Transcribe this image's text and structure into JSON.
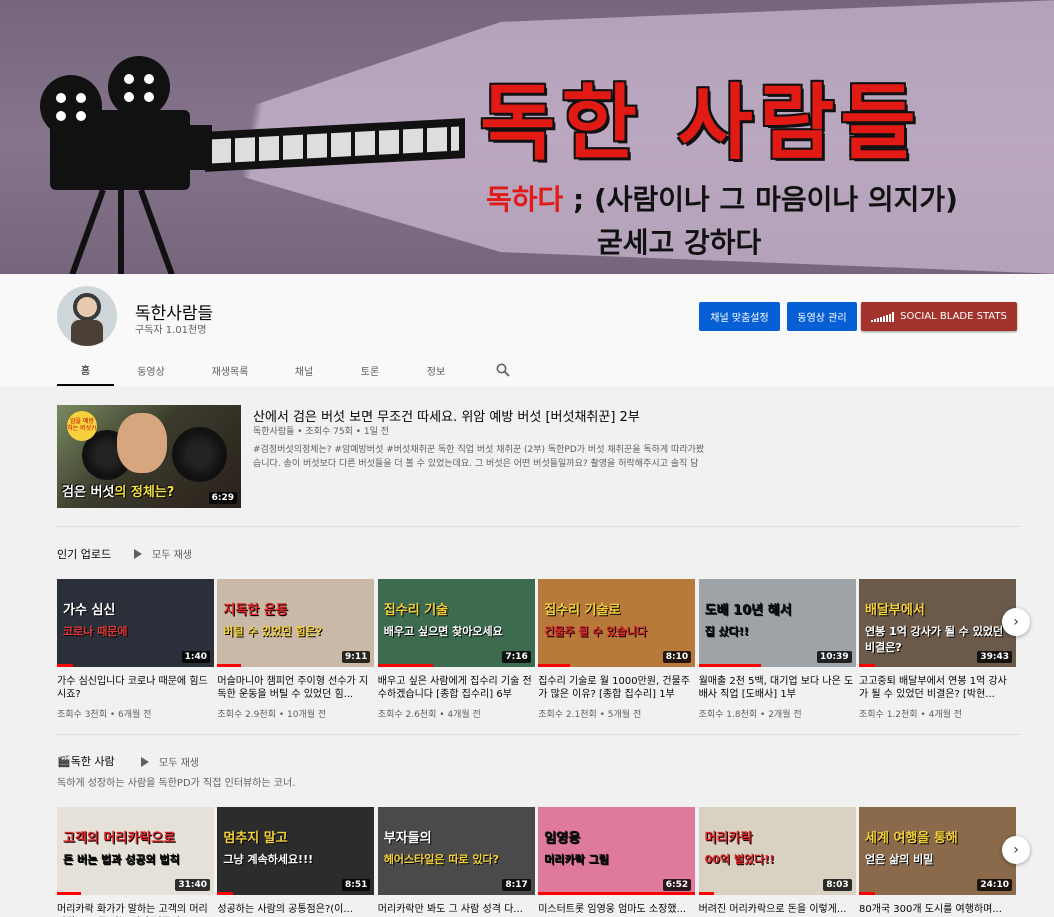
{
  "banner": {
    "title": "독한 사람들",
    "subtitle_highlight": "독하다",
    "subtitle_rest": " ; (사람이나 그 마음이나 의지가)",
    "subtitle_line2": "굳세고 강하다"
  },
  "channel": {
    "name": "독한사람들",
    "subscribers": "구독자 1.01천명"
  },
  "buttons": {
    "customize": "채널 맞춤설정",
    "manage": "동영상 관리",
    "socialblade": "SOCIAL BLADE STATS"
  },
  "tabs": [
    "홈",
    "동영상",
    "재생목록",
    "채널",
    "토론",
    "정보"
  ],
  "featured": {
    "title": "산에서 검은 버섯 보면 무조건 따세요. 위암 예방 버섯 [버섯채취꾼] 2부",
    "meta": "독한사람들 • 조회수 75회 • 1일 전",
    "description": "#검정버섯의정체는? #암예방버섯 #버섯채취꾼 독한 직업 버섯 채취꾼 (2부) 독한PD가 버섯 채취꾼을 독하게 따라가봤습니다. 송이 버섯보다 다른 버섯들을 더 볼 수 있었는데요. 그 버섯은 어떤 버섯들일까요? 촬영을 허락해주시고 솔직 담",
    "thumb_tag": "암을 예방 하는 버섯?!",
    "thumb_caption_a": "검은 버섯",
    "thumb_caption_b": "의 정체는?",
    "duration": "6:29"
  },
  "shelf1": {
    "title": "인기 업로드",
    "play_all": "모두 재생",
    "videos": [
      {
        "title": "가수 심신입니다 코로나 때문에 힘드시죠?",
        "meta": "조회수 3천회 • 6개월 전",
        "duration": "1:40",
        "t1": "가수 심신",
        "t2": "코로나 때문에",
        "bg": "#2b2f3a",
        "c1": "#ffffff",
        "c2": "#e03a3a",
        "progress": 0.1
      },
      {
        "title": "머슬마니아 챔피언 주이형 선수가 지독한 운동을 버틸 수 있었던 힘...",
        "meta": "조회수 2.9천회 • 10개월 전",
        "duration": "9:11",
        "t1": "지독한 운동",
        "t2": "버틸 수 있었던 힘은?",
        "bg": "#c9b9a6",
        "c1": "#e02a2a",
        "c2": "#f4d13d",
        "progress": 0.15
      },
      {
        "title": "배우고 싶은 사람에게 집수리 기술 전수하겠습니다 [종합 집수리] 6부",
        "meta": "조회수 2.6천회 • 4개월 전",
        "duration": "7:16",
        "t1": "집수리 기술",
        "t2": "배우고 싶으면 찾아오세요",
        "bg": "#3d6b4f",
        "c1": "#f4d13d",
        "c2": "#ffffff",
        "progress": 0.35
      },
      {
        "title": "집수리 기술로 월 1000만원, 건물주가 많은 이유? [종합 집수리] 1부",
        "meta": "조회수 2.1천회 • 5개월 전",
        "duration": "8:10",
        "t1": "집수리 기술로",
        "t2": "건물주 될 수 있습니다",
        "bg": "#b87a3a",
        "c1": "#f4d13d",
        "c2": "#e02a2a",
        "progress": 0.2
      },
      {
        "title": "월매출 2천 5백, 대기업 보다 나은 도배사 직업 [도배사] 1부",
        "meta": "조회수 1.8천회 • 2개월 전",
        "duration": "10:39",
        "t1": "도배 10년 해서",
        "t2": "집 샀다!!",
        "bg": "#9ea3a8",
        "c1": "#111111",
        "c2": "#111111",
        "progress": 0.4
      },
      {
        "title": "고고중퇴 배달부에서 연봉 1억 강사가 될 수 있었던 비결은? [박현...",
        "meta": "조회수 1.2천회 • 4개월 전",
        "duration": "39:43",
        "t1": "배달부에서",
        "t2": "연봉 1억 강사가 될 수 있었던 비결은?",
        "bg": "#6b5a4a",
        "c1": "#f4d13d",
        "c2": "#ffffff",
        "progress": 0.1
      }
    ]
  },
  "shelf2": {
    "title": "🎬독한 사람",
    "play_all": "모두 재생",
    "description": "독하게 성장하는 사람을 독한PD가 직접 인터뷰하는 코너.",
    "videos": [
      {
        "title": "머리카락 화가가 말하는 고객의 머리카락으로 돈 버는 법과 성공의...",
        "duration": "31:40",
        "t1": "고객의 머리카락으로",
        "t2": "돈 버는 법과 성공의 법칙",
        "bg": "#e6e1d8",
        "c1": "#e02a2a",
        "c2": "#111111",
        "progress": 0.15
      },
      {
        "title": "성공하는 사람의 공통점은?(이...",
        "duration": "8:51",
        "t1": "멈추지 말고",
        "t2": "그냥 계속하세요!!!",
        "bg": "#2c2c2c",
        "c1": "#f4d13d",
        "c2": "#ffffff",
        "progress": 0.1
      },
      {
        "title": "머리카락만 봐도 그 사람 성격 다...",
        "duration": "8:17",
        "t1": "부자들의",
        "t2": "헤어스타일은 따로 있다?",
        "bg": "#4a4a4a",
        "c1": "#ffffff",
        "c2": "#f4d13d",
        "progress": 0.0
      },
      {
        "title": "미스터트롯 임영웅 엄마도 소장했...",
        "duration": "6:52",
        "t1": "임영웅",
        "t2": "머리카락 그림",
        "bg": "#e07a9a",
        "c1": "#111111",
        "c2": "#111111",
        "progress": 1.0
      },
      {
        "title": "버려진 머리카락으로 돈을 이렇게...",
        "duration": "8:03",
        "t1": "머리카락",
        "t2": "00억 벌었다!!",
        "bg": "#d9d2c3",
        "c1": "#e02a2a",
        "c2": "#e02a2a",
        "progress": 0.1
      },
      {
        "title": "80개국 300개 도시를 여행하며...",
        "duration": "24:10",
        "t1": "세계 여행을 통해",
        "t2": "얻은 삶의 비밀",
        "bg": "#8a6a4a",
        "c1": "#f4d13d",
        "c2": "#ffffff",
        "progress": 0.1
      }
    ]
  },
  "icons": {
    "search": "search-icon",
    "next": "chevron-right-icon",
    "play": "play-icon",
    "socialblade": "signal-bars-icon"
  },
  "colors": {
    "primary_button": "#065fd4",
    "socialblade_button": "#a2342d",
    "progress": "#ff0000"
  }
}
